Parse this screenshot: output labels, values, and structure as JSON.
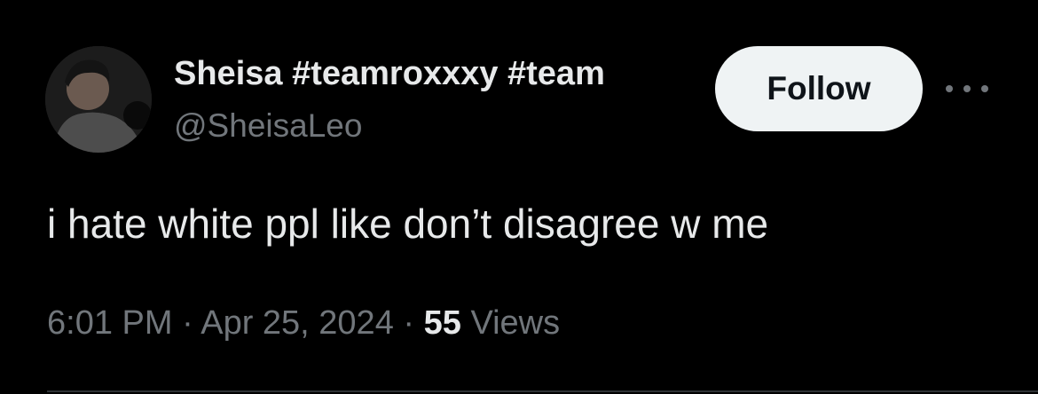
{
  "author": {
    "display_name": "Sheisa #teamroxxxy #team",
    "handle": "@SheisaLeo"
  },
  "actions": {
    "follow_label": "Follow",
    "more_icon": "ellipsis-horizontal-icon"
  },
  "tweet": {
    "text": "i hate white ppl like don’t disagree w me"
  },
  "meta": {
    "time": "6:01 PM",
    "separator_1": " · ",
    "date": "Apr 25, 2024",
    "separator_2": " · ",
    "views_count": "55",
    "views_label": " Views"
  },
  "colors": {
    "background": "#000000",
    "primary_text": "#e7e9ea",
    "secondary_text": "#71767b",
    "follow_button_bg": "#eff3f4",
    "follow_button_text": "#0f1419"
  }
}
